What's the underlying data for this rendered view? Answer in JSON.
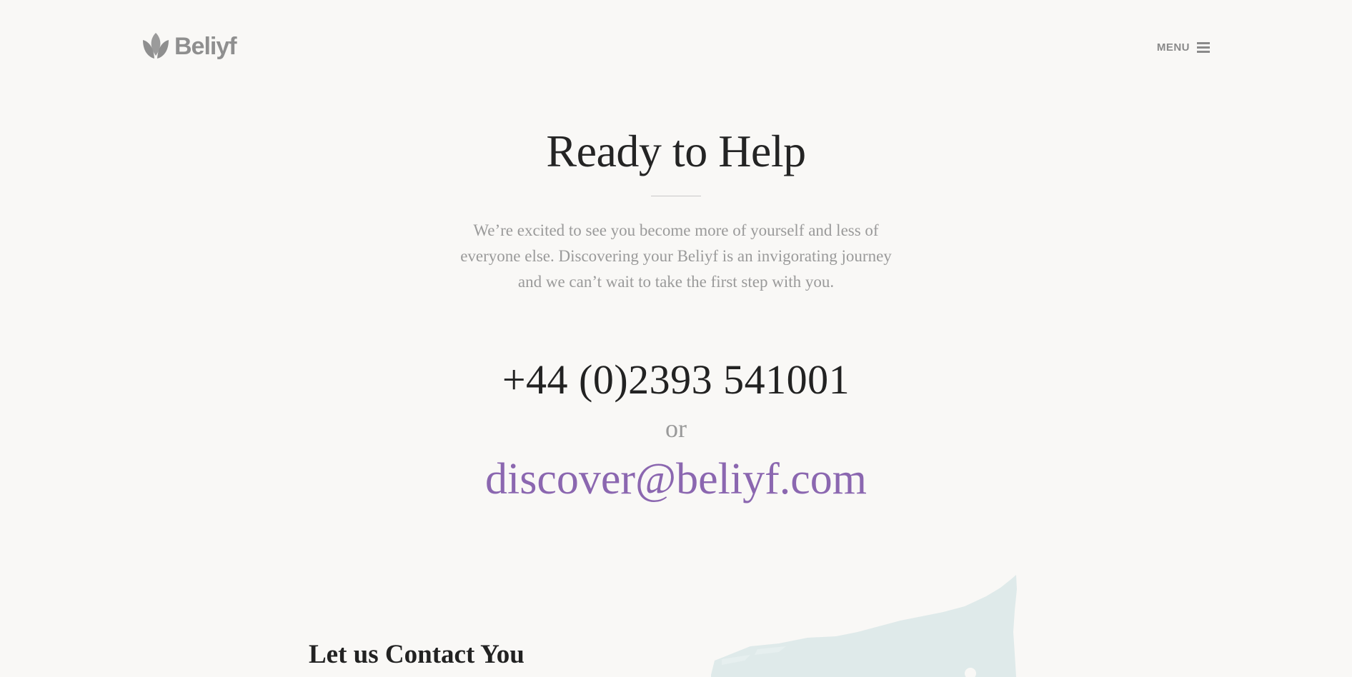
{
  "header": {
    "logo_text": "Beliyf",
    "logo_icon": "leaf-logo-icon",
    "menu_label": "MENU",
    "menu_icon": "hamburger-icon"
  },
  "hero": {
    "title": "Ready to Help",
    "text": "We’re excited to see you become more of yourself and less of everyone else. Discovering your Beliyf is an invigorating journey and we can’t wait to take the first step with you."
  },
  "contact": {
    "phone": "+44 (0)2393 541001",
    "or_text": "or",
    "email": "discover@beliyf.com"
  },
  "form_section": {
    "heading": "Let us Contact You"
  },
  "colors": {
    "background": "#f9f8f6",
    "accent": "#8b67b0",
    "muted_text": "#9a9a9a",
    "brush_stroke": "#dfeaea"
  }
}
